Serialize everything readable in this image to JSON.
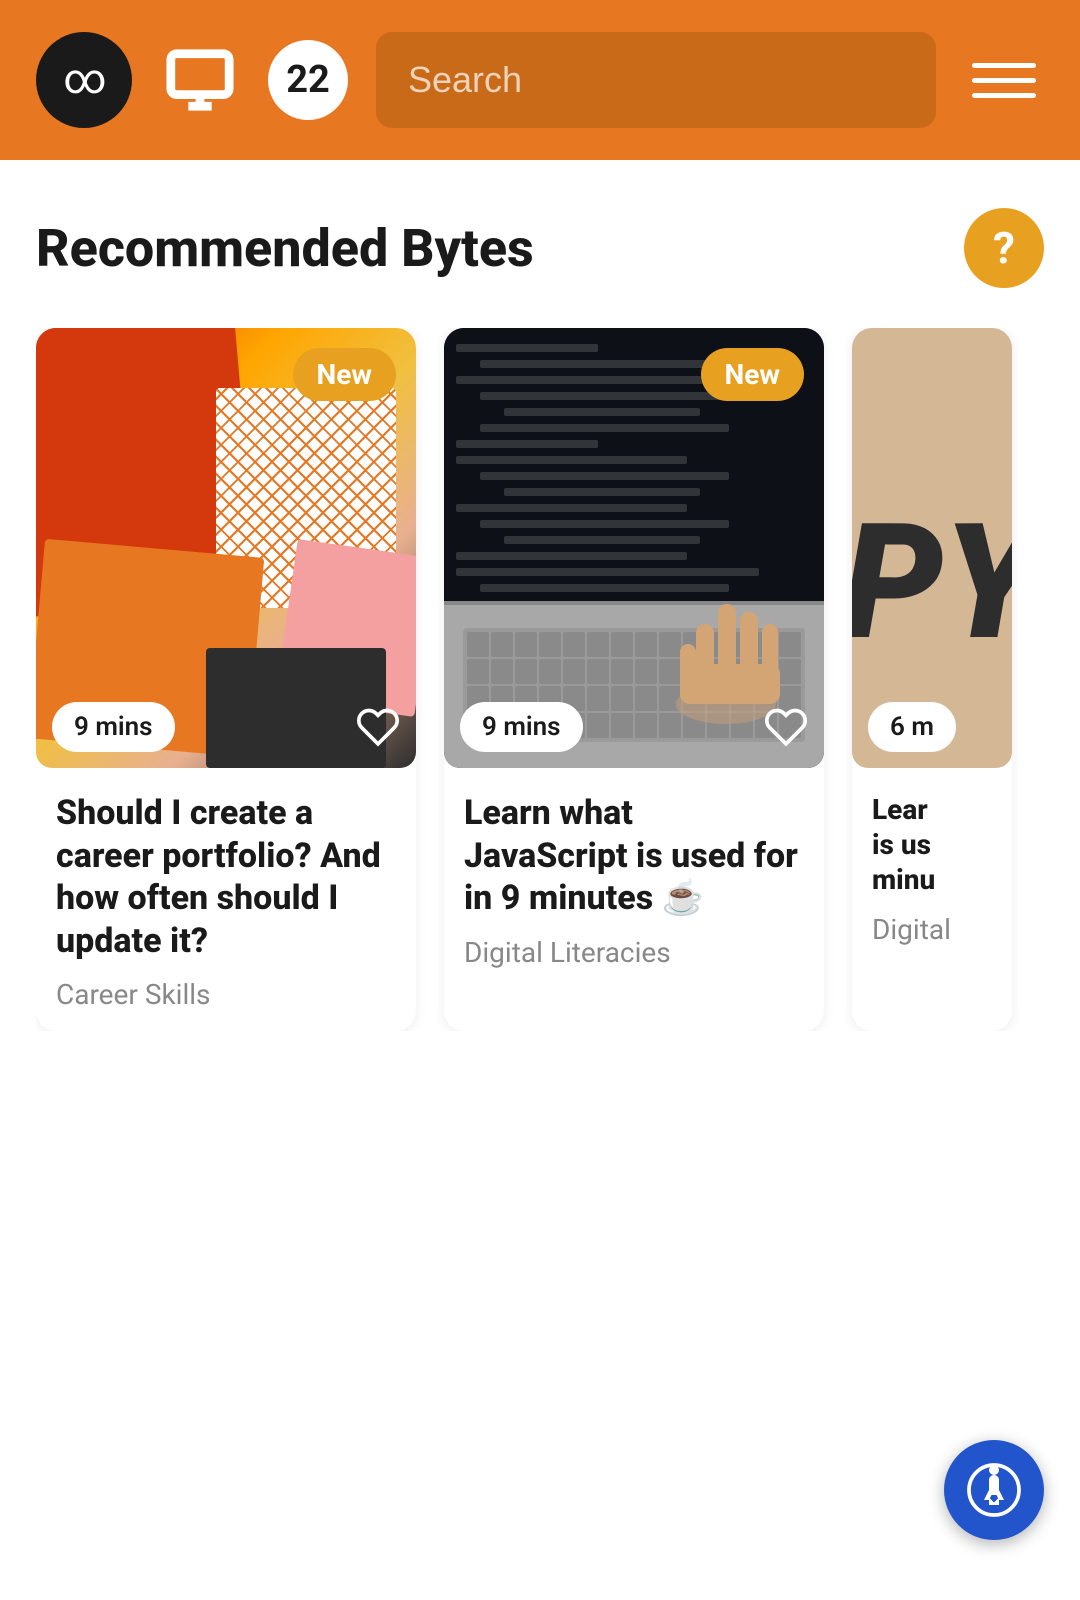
{
  "header": {
    "logo_alt": "Infinity Logo",
    "badge_count": "22",
    "search_placeholder": "Search",
    "menu_label": "Menu"
  },
  "section": {
    "title": "Recommended Bytes",
    "help_label": "?"
  },
  "cards": [
    {
      "id": "card-1",
      "badge": "New",
      "time": "9 mins",
      "title": "Should I create a career portfolio? And how often should I update it?",
      "category": "Career Skills",
      "has_new_badge": true
    },
    {
      "id": "card-2",
      "badge": "New",
      "time": "9 mins",
      "title": "Learn what JavaScript is used for in 9 minutes ☕",
      "category": "Digital Literacies",
      "has_new_badge": true
    },
    {
      "id": "card-3",
      "badge": "",
      "time": "6 m",
      "title": "Learn Python is used in minutes",
      "category": "Digital",
      "has_new_badge": false,
      "partial": true
    }
  ],
  "accessibility": {
    "label": "Accessibility options"
  }
}
